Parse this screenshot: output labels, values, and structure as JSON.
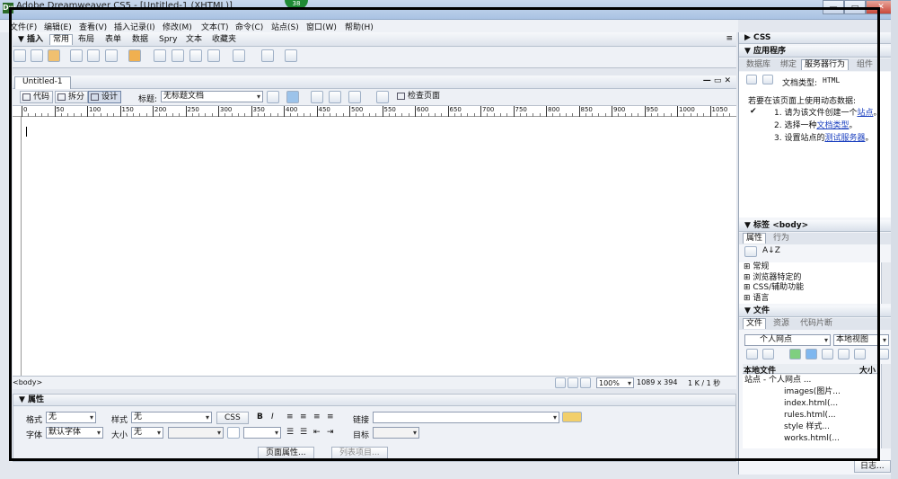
{
  "window": {
    "title": "Adobe Dreamweaver CS5 - [Untitled-1 (XHTML)]",
    "badge": "38",
    "minimize": "—",
    "restore": "▭",
    "close": "✕"
  },
  "menu": [
    "文件(F)",
    "编辑(E)",
    "查看(V)",
    "插入记录(I)",
    "修改(M)",
    "文本(T)",
    "命令(C)",
    "站点(S)",
    "窗口(W)",
    "帮助(H)"
  ],
  "insert_panel": {
    "title": "▼ 插入",
    "tabs": [
      "常用",
      "布局",
      "表单",
      "数据",
      "Spry",
      "文本",
      "收藏夹"
    ]
  },
  "document": {
    "tab": "Untitled-1",
    "view_buttons": [
      "代码",
      "拆分",
      "设计"
    ],
    "title_label": "标题:",
    "title_value": "无标题文档",
    "check_page": "检查页面",
    "ruler_ticks": [
      "0",
      "50",
      "100",
      "150",
      "200",
      "250",
      "300",
      "350",
      "400",
      "450",
      "500",
      "550",
      "600",
      "650",
      "700",
      "750",
      "800",
      "850",
      "900",
      "950",
      "1000",
      "1050"
    ]
  },
  "status": {
    "tag": "<body>",
    "zoom": "100%",
    "size": "1089 x 394",
    "info": "1 K / 1 秒"
  },
  "properties": {
    "title": "▼ 属性",
    "format_label": "格式",
    "format_value": "无",
    "style_label": "样式",
    "style_value": "无",
    "css_button": "CSS",
    "bold": "B",
    "italic": "I",
    "link_label": "链接",
    "font_label": "字体",
    "font_value": "默认字体",
    "size_label": "大小",
    "size_value": "无",
    "target_label": "目标",
    "page_props_button": "页面属性...",
    "list_item_button": "列表项目..."
  },
  "right": {
    "css": "▶ CSS",
    "app": {
      "title": "▼ 应用程序",
      "tabs": [
        "数据库",
        "绑定",
        "服务器行为",
        "组件"
      ],
      "doctype_label": "文档类型:",
      "doctype_value": "HTML",
      "intro": "若要在该页面上使用动态数据:",
      "check": "✔",
      "steps": [
        {
          "pre": "1. 请为该文件创建一个",
          "link": "站点",
          "post": "。"
        },
        {
          "pre": "2. 选择一种",
          "link": "文档类型",
          "post": "。"
        },
        {
          "pre": "3. 设置站点的",
          "link": "测试服务器",
          "post": "。"
        }
      ]
    },
    "tag": {
      "title": "▼ 标签 <body>",
      "tabs": [
        "属性",
        "行为"
      ],
      "cats": [
        "⊞ 常规",
        "⊞ 浏览器特定的",
        "⊞ CSS/辅助功能",
        "⊞ 语言"
      ]
    },
    "files": {
      "title": "▼ 文件",
      "tabs": [
        "文件",
        "资源",
        "代码片断"
      ],
      "site": "个人网点",
      "view": "本地视图",
      "col_local": "本地文件",
      "col_size": "大小",
      "items": [
        "站点 - 个人网点 ...",
        "images(图片...",
        "index.html(...",
        "rules.html(...",
        "style 样式...",
        "works.html(..."
      ],
      "log": "日志..."
    }
  },
  "accent": "#3b6fb6"
}
